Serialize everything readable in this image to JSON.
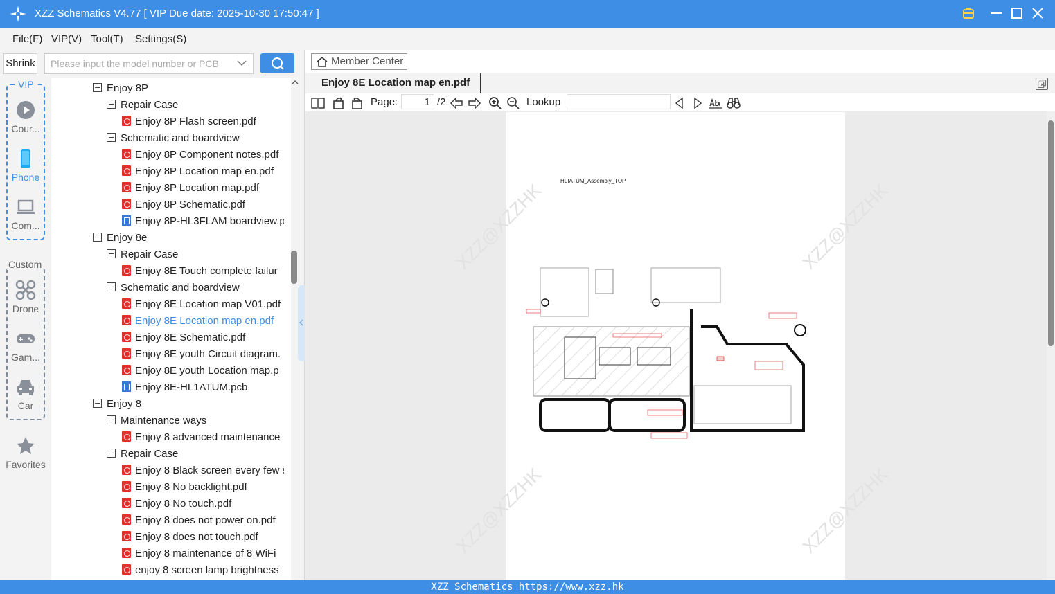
{
  "window": {
    "title": "XZZ Schematics V4.77 [ VIP Due date: 2025-10-30 17:50:47 ]"
  },
  "menu": [
    "File(F)",
    "VIP(V)",
    "Tool(T)",
    "Settings(S)"
  ],
  "left": {
    "shrink_label": "Shrink",
    "search_placeholder": "Please input the model number or PCB",
    "vip_label": "VIP",
    "custom_label": "Custom",
    "categories": [
      {
        "label": "Cour...",
        "icon": "play-icon"
      },
      {
        "label": "Phone",
        "icon": "phone-icon"
      },
      {
        "label": "Com...",
        "icon": "laptop-icon"
      },
      {
        "label": "Drone",
        "icon": "drone-icon"
      },
      {
        "label": "Gam...",
        "icon": "gamepad-icon"
      },
      {
        "label": "Car",
        "icon": "car-icon"
      },
      {
        "label": "Favorites",
        "icon": "star-icon"
      }
    ]
  },
  "tree": [
    {
      "label": "Enjoy 8P",
      "type": "folder",
      "level": 0
    },
    {
      "label": "Repair Case",
      "type": "folder",
      "level": 1
    },
    {
      "label": "Enjoy 8P Flash screen.pdf",
      "type": "pdf",
      "level": 2
    },
    {
      "label": "Schematic and boardview",
      "type": "folder",
      "level": 1
    },
    {
      "label": "Enjoy 8P Component notes.pdf",
      "type": "pdf",
      "level": 2
    },
    {
      "label": "Enjoy 8P Location map en.pdf",
      "type": "pdf",
      "level": 2
    },
    {
      "label": "Enjoy 8P Location map.pdf",
      "type": "pdf",
      "level": 2
    },
    {
      "label": "Enjoy 8P Schematic.pdf",
      "type": "pdf",
      "level": 2
    },
    {
      "label": "Enjoy 8P-HL3FLAM boardview.p",
      "type": "pcb",
      "level": 2
    },
    {
      "label": "Enjoy 8e",
      "type": "folder",
      "level": 0
    },
    {
      "label": "Repair Case",
      "type": "folder",
      "level": 1
    },
    {
      "label": "Enjoy 8E Touch complete failur",
      "type": "pdf",
      "level": 2
    },
    {
      "label": "Schematic and boardview",
      "type": "folder",
      "level": 1
    },
    {
      "label": "Enjoy 8E Location map V01.pdf",
      "type": "pdf",
      "level": 2
    },
    {
      "label": "Enjoy 8E Location map en.pdf",
      "type": "pdf",
      "level": 2,
      "selected": true
    },
    {
      "label": "Enjoy 8E Schematic.pdf",
      "type": "pdf",
      "level": 2
    },
    {
      "label": "Enjoy 8E youth Circuit diagram.",
      "type": "pdf",
      "level": 2
    },
    {
      "label": "Enjoy 8E youth Location map.p",
      "type": "pdf",
      "level": 2
    },
    {
      "label": "Enjoy 8E-HL1ATUM.pcb",
      "type": "pcb",
      "level": 2
    },
    {
      "label": "Enjoy 8",
      "type": "folder",
      "level": 0
    },
    {
      "label": "Maintenance ways",
      "type": "folder",
      "level": 1
    },
    {
      "label": "Enjoy 8 advanced maintenance",
      "type": "pdf",
      "level": 2
    },
    {
      "label": "Repair Case",
      "type": "folder",
      "level": 1
    },
    {
      "label": "Enjoy 8 Black screen every few s",
      "type": "pdf",
      "level": 2
    },
    {
      "label": "Enjoy 8 No backlight.pdf",
      "type": "pdf",
      "level": 2
    },
    {
      "label": "Enjoy 8 No touch.pdf",
      "type": "pdf",
      "level": 2
    },
    {
      "label": "Enjoy 8 does not power on.pdf",
      "type": "pdf",
      "level": 2
    },
    {
      "label": "Enjoy 8 does not touch.pdf",
      "type": "pdf",
      "level": 2
    },
    {
      "label": "Enjoy 8 maintenance of 8 WiFi",
      "type": "pdf",
      "level": 2
    },
    {
      "label": "enjoy 8 screen lamp brightness",
      "type": "pdf",
      "level": 2
    }
  ],
  "main": {
    "member_center": "Member Center",
    "tab_title": "Enjoy 8E Location map en.pdf",
    "page_label": "Page:",
    "page_current": "1",
    "page_total": "/2",
    "lookup_label": "Lookup",
    "doc_heading": "HLIATUM_Assembly_TOP",
    "watermark": "XZZ@XZZHK"
  },
  "status": {
    "text": "XZZ Schematics https://www.xzz.hk"
  },
  "colors": {
    "accent": "#3d8ee4",
    "pdf_icon": "#e03030",
    "selected_text": "#3d8ee4"
  }
}
